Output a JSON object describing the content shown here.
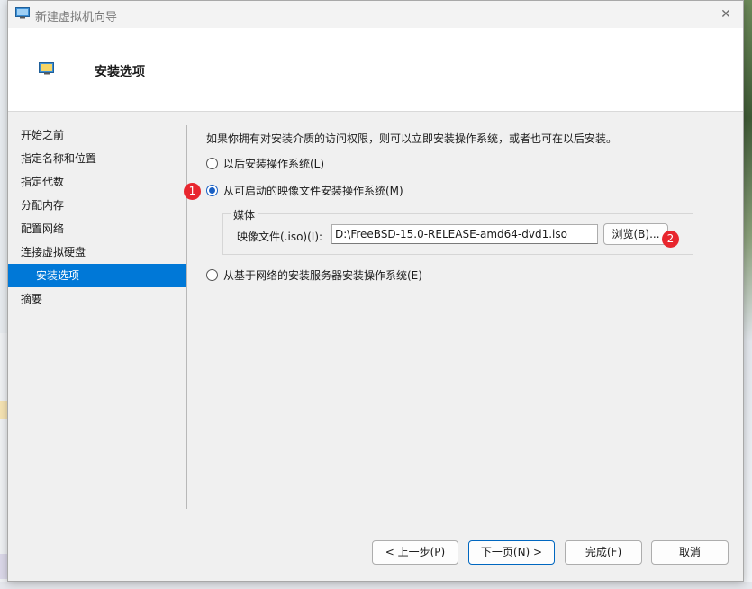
{
  "window": {
    "title": "新建虚拟机向导",
    "close_glyph": "✕"
  },
  "header": {
    "title": "安装选项"
  },
  "sidebar": {
    "items": [
      {
        "label": "开始之前"
      },
      {
        "label": "指定名称和位置"
      },
      {
        "label": "指定代数"
      },
      {
        "label": "分配内存"
      },
      {
        "label": "配置网络"
      },
      {
        "label": "连接虚拟硬盘"
      },
      {
        "label": "安装选项",
        "active": true
      },
      {
        "label": "摘要"
      }
    ]
  },
  "main": {
    "intro": "如果你拥有对安装介质的访问权限，则可以立即安装操作系统，或者也可在以后安装。",
    "options": {
      "later": {
        "label": "以后安装操作系统(L)",
        "selected": false
      },
      "image": {
        "label": "从可启动的映像文件安装操作系统(M)",
        "selected": true
      },
      "network": {
        "label": "从基于网络的安装服务器安装操作系统(E)",
        "selected": false
      }
    },
    "media": {
      "legend": "媒体",
      "file_label": "映像文件(.iso)(I):",
      "file_value": "D:\\FreeBSD-15.0-RELEASE-amd64-dvd1.iso",
      "browse_label": "浏览(B)..."
    }
  },
  "markers": [
    "1",
    "2"
  ],
  "footer": {
    "prev_label": "< 上一步(P)",
    "next_label": "下一页(N) >",
    "finish_label": "完成(F)",
    "cancel_label": "取消"
  },
  "colors": {
    "accent": "#0078d7",
    "marker": "#e8262e"
  }
}
